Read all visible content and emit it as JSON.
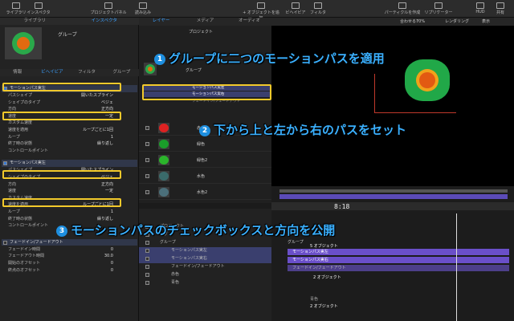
{
  "top": {
    "library": "ライブラリ",
    "inspector": "インスペクタ",
    "project_panel": "プロジェクトパネル",
    "files": "読み込み",
    "add_object": "+ オブジェクトを追加",
    "behaviors": "ビヘイビア",
    "filters": "フィルタ",
    "particles": "パーティクルを作成",
    "replicator": "リプリケーター",
    "hud": "HUD",
    "share": "共有",
    "fit": "合わせる：",
    "zoom": "70%",
    "rendering": "レンダリング",
    "view": "表示"
  },
  "left": {
    "tabs": [
      "ライブラリ",
      "インスペクタ"
    ],
    "group_title": "グループ",
    "subtabs": [
      "情報",
      "ビヘイビア",
      "フィルタ",
      "グループ"
    ],
    "sections": [
      {
        "title": "モーションパス実左",
        "rows": [
          [
            "パスシェイプ",
            "開いたスプライン"
          ],
          [
            "シェイプのタイプ",
            "ベジェ"
          ],
          [
            "方向",
            "正方向"
          ],
          [
            "速度",
            "一定"
          ],
          [
            "カスタム速度",
            ""
          ],
          [
            "速度を適用",
            "ループごとに1回"
          ],
          [
            "ループ",
            "1"
          ],
          [
            "終了時の状態",
            "繰り返し"
          ],
          [
            "コントロールポイント",
            ""
          ]
        ]
      },
      {
        "title": "モーションパス実左",
        "rows": [
          [
            "パスシェイプ",
            "開いたスプライン"
          ],
          [
            "シェイプのタイプ",
            "ベジェ"
          ],
          [
            "方向",
            "正方向"
          ],
          [
            "速度",
            "一定"
          ],
          [
            "カスタム速度",
            ""
          ],
          [
            "速度を適用",
            "ループごとに1回"
          ],
          [
            "ループ",
            "1"
          ],
          [
            "終了時の状態",
            "繰り返し"
          ],
          [
            "コントロールポイント",
            ""
          ]
        ]
      }
    ],
    "fade": {
      "title": "フェードイン/フェードアウト",
      "rows": [
        [
          "フェードイン時間",
          "0"
        ],
        [
          "フェードアウト時間",
          "30.0"
        ],
        [
          "開始のオフセット",
          "0"
        ],
        [
          "終点のオフセット",
          "0"
        ]
      ]
    }
  },
  "mid": {
    "tabs": [
      "レイヤー",
      "メディア",
      "オーディオ"
    ],
    "project": "プロジェクト",
    "group": "グループ",
    "path1": "モーションパス実左",
    "path2": "モーションパス実右",
    "fade": "フェードイン/フェードアウト",
    "layers": [
      "赤色",
      "緑色",
      "緑色2",
      "水色",
      "水色2"
    ]
  },
  "timeline": {
    "timecode": "8:18",
    "group": "グループ",
    "group_objs": "5 オブジェクト",
    "bars": [
      "モーションパス実左",
      "モーションパス実右",
      "フェードイン/フェードアウト"
    ],
    "color": "赤色",
    "color_objs": "2 オブジェクト",
    "blue": "青色",
    "blue_objs": "2 オブジェクト"
  },
  "midlow": {
    "rows": [
      "プロジェクト",
      "リグ",
      "グループ",
      "モーションパス実左",
      "モーションパス実右",
      "フェードイン/フェードアウト",
      "赤色",
      "青色"
    ]
  },
  "annotations": [
    {
      "num": "1",
      "text": "グループに二つのモーションパスを適用"
    },
    {
      "num": "2",
      "text": "下から上と左から右のパスをセット"
    },
    {
      "num": "3",
      "text": "モーションパスのチェックボックスと方向を公開"
    }
  ],
  "colors": {
    "accent": "#3ab0ff",
    "highlight": "#f2c92b",
    "purple": "#6a4fc9"
  }
}
